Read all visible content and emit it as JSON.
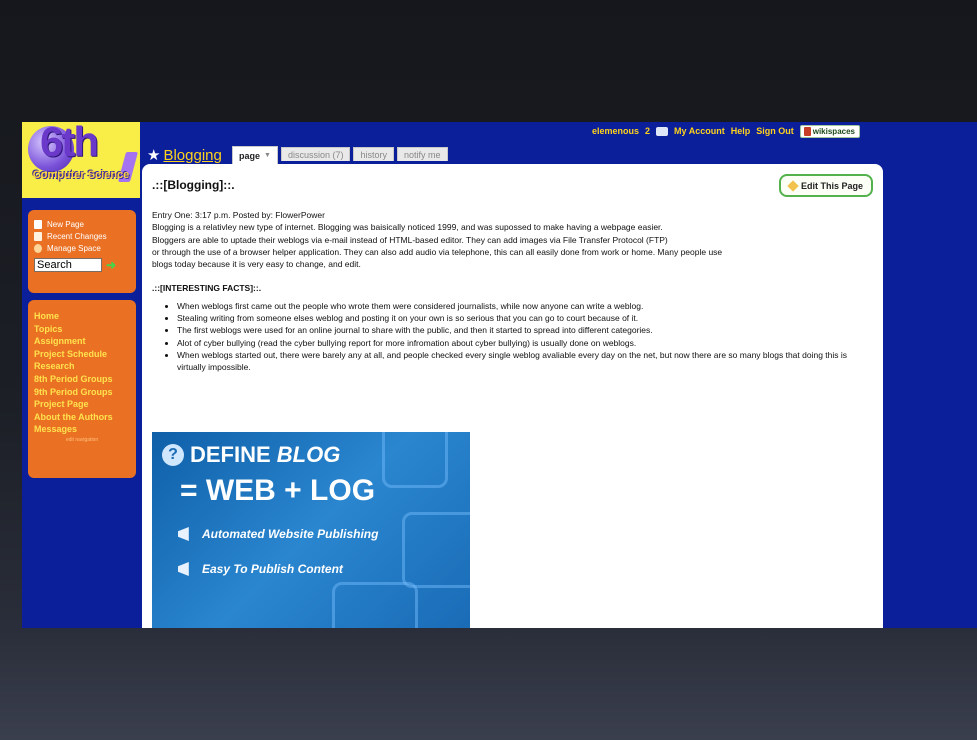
{
  "userbar": {
    "username": "elemenous",
    "message_count": "2",
    "my_account": "My Account",
    "help": "Help",
    "sign_out": "Sign Out",
    "wikispaces": "wikispaces"
  },
  "logo": {
    "big": "6th",
    "sub": "Computer Science"
  },
  "sidebar_tools": {
    "new_page": "New Page",
    "recent_changes": "Recent Changes",
    "manage_space": "Manage Space",
    "search_value": "Search"
  },
  "navigation": {
    "items": [
      "Home",
      "Topics",
      "Assignment",
      "Project Schedule",
      "Research",
      "8th Period Groups",
      "9th Period Groups",
      "Project Page",
      "About the Authors",
      "Messages"
    ],
    "edit_navigation": "edit navigation"
  },
  "page": {
    "title": "Blogging",
    "tabs": {
      "page": "page",
      "discussion": "discussion (7)",
      "history": "history",
      "notify": "notify me"
    },
    "edit_button": "Edit This Page",
    "heading": ".::[Blogging]::.",
    "paragraphs": [
      "Entry One: 3:17 p.m. Posted by: FlowerPower",
      "Blogging is a relativley new type of internet. Blogging was baisically noticed 1999, and was supossed to make having a webpage easier.",
      "Bloggers are able to uptade their weblogs via e-mail instead of HTML-based editor. They can add images via File Transfer Protocol (FTP)",
      "or through the use of a browser helper application. They can also add audio via telephone, this can all easily done from work or home. Many people use",
      "blogs today because it is very easy to change, and edit."
    ],
    "facts_heading": ".::[INTERESTING FACTS]::.",
    "facts": [
      "When weblogs first came out the people who wrote them were considered journalists, while now anyone can write a weblog.",
      "Stealing writing from someone elses weblog and posting it on your own is so serious that you can go to court because of it.",
      "The first weblogs were used for an online journal to share with the public, and then it started to spread into different categories.",
      "Alot of cyber bullying (read the cyber bullying report for more infromation about cyber bullying) is usually done on weblogs.",
      "When weblogs started out, there were barely any at all, and people checked every single weblog avaliable every day on the net, but now there are so many blogs that doing this is virtually impossible."
    ]
  },
  "image": {
    "line1_a": "DEFINE ",
    "line1_b": "BLOG",
    "line2": "= WEB + LOG",
    "bullet1": "Automated Website Publishing",
    "bullet2": "Easy To Publish Content"
  }
}
